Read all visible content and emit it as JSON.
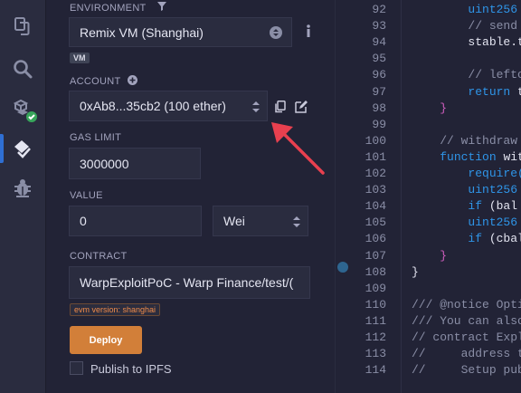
{
  "sidebar": {
    "icons": [
      "files-icon",
      "search-icon",
      "compile-icon",
      "deploy-run-icon",
      "debugger-icon"
    ]
  },
  "panel": {
    "environment_label": "ENVIRONMENT",
    "environment_value": "Remix VM (Shanghai)",
    "vm_badge": "VM",
    "account_label": "ACCOUNT",
    "account_value": "0xAb8...35cb2 (100 ether)",
    "gas_limit_label": "GAS LIMIT",
    "gas_limit_value": "3000000",
    "value_label": "VALUE",
    "value_amount": "0",
    "value_unit": "Wei",
    "contract_label": "CONTRACT",
    "contract_value": "WarpExploitPoC - Warp Finance/test/(",
    "evm_badge": "evm version: shanghai",
    "deploy_label": "Deploy",
    "publish_label": "Publish to IPFS",
    "colors": {
      "deploy_bg": "#d27f39",
      "arrow": "#e8404f",
      "vm_badge_bg": "#3f4456",
      "evm_badge_fg": "#f08b4a"
    }
  },
  "editor": {
    "lines": [
      {
        "n": "92",
        "code": [
          {
            "t": "        ",
            "c": ""
          },
          {
            "t": "uint256",
            "c": "kw"
          }
        ]
      },
      {
        "n": "93",
        "code": [
          {
            "t": "        ",
            "c": ""
          },
          {
            "t": "// send",
            "c": "cm"
          }
        ]
      },
      {
        "n": "94",
        "code": [
          {
            "t": "        stable.t",
            "c": ""
          }
        ]
      },
      {
        "n": "95",
        "code": [
          {
            "t": "",
            "c": ""
          }
        ]
      },
      {
        "n": "96",
        "code": [
          {
            "t": "        ",
            "c": ""
          },
          {
            "t": "// lefto",
            "c": "cm"
          }
        ]
      },
      {
        "n": "97",
        "code": [
          {
            "t": "        ",
            "c": ""
          },
          {
            "t": "return",
            "c": "kw"
          },
          {
            "t": " t",
            "c": ""
          }
        ]
      },
      {
        "n": "98",
        "code": [
          {
            "t": "    ",
            "c": ""
          },
          {
            "t": "}",
            "c": "br"
          }
        ]
      },
      {
        "n": "99",
        "code": [
          {
            "t": "",
            "c": ""
          }
        ]
      },
      {
        "n": "100",
        "code": [
          {
            "t": "    ",
            "c": ""
          },
          {
            "t": "// withdraw",
            "c": "cm"
          }
        ]
      },
      {
        "n": "101",
        "code": [
          {
            "t": "    ",
            "c": ""
          },
          {
            "t": "function",
            "c": "kw"
          },
          {
            "t": " wit",
            "c": ""
          }
        ]
      },
      {
        "n": "102",
        "code": [
          {
            "t": "        ",
            "c": ""
          },
          {
            "t": "require(",
            "c": "kw"
          }
        ]
      },
      {
        "n": "103",
        "code": [
          {
            "t": "        ",
            "c": ""
          },
          {
            "t": "uint256",
            "c": "kw"
          }
        ]
      },
      {
        "n": "104",
        "code": [
          {
            "t": "        ",
            "c": ""
          },
          {
            "t": "if",
            "c": "kw"
          },
          {
            "t": " (bal",
            "c": ""
          }
        ]
      },
      {
        "n": "105",
        "code": [
          {
            "t": "        ",
            "c": ""
          },
          {
            "t": "uint256",
            "c": "kw"
          }
        ]
      },
      {
        "n": "106",
        "code": [
          {
            "t": "        ",
            "c": ""
          },
          {
            "t": "if",
            "c": "kw"
          },
          {
            "t": " (cbal",
            "c": ""
          }
        ]
      },
      {
        "n": "107",
        "code": [
          {
            "t": "    ",
            "c": ""
          },
          {
            "t": "}",
            "c": "br"
          }
        ]
      },
      {
        "n": "108",
        "code": [
          {
            "t": "}",
            "c": ""
          }
        ]
      },
      {
        "n": "109",
        "code": [
          {
            "t": "",
            "c": ""
          }
        ]
      },
      {
        "n": "110",
        "code": [
          {
            "t": "/// @notice Opti",
            "c": "cm"
          }
        ]
      },
      {
        "n": "111",
        "code": [
          {
            "t": "/// You can also",
            "c": "cm"
          }
        ]
      },
      {
        "n": "112",
        "code": [
          {
            "t": "// contract Expl",
            "c": "cm"
          }
        ]
      },
      {
        "n": "113",
        "code": [
          {
            "t": "//     address t",
            "c": "cm"
          }
        ]
      },
      {
        "n": "114",
        "code": [
          {
            "t": "//     Setup pub",
            "c": "cm"
          }
        ]
      }
    ]
  }
}
